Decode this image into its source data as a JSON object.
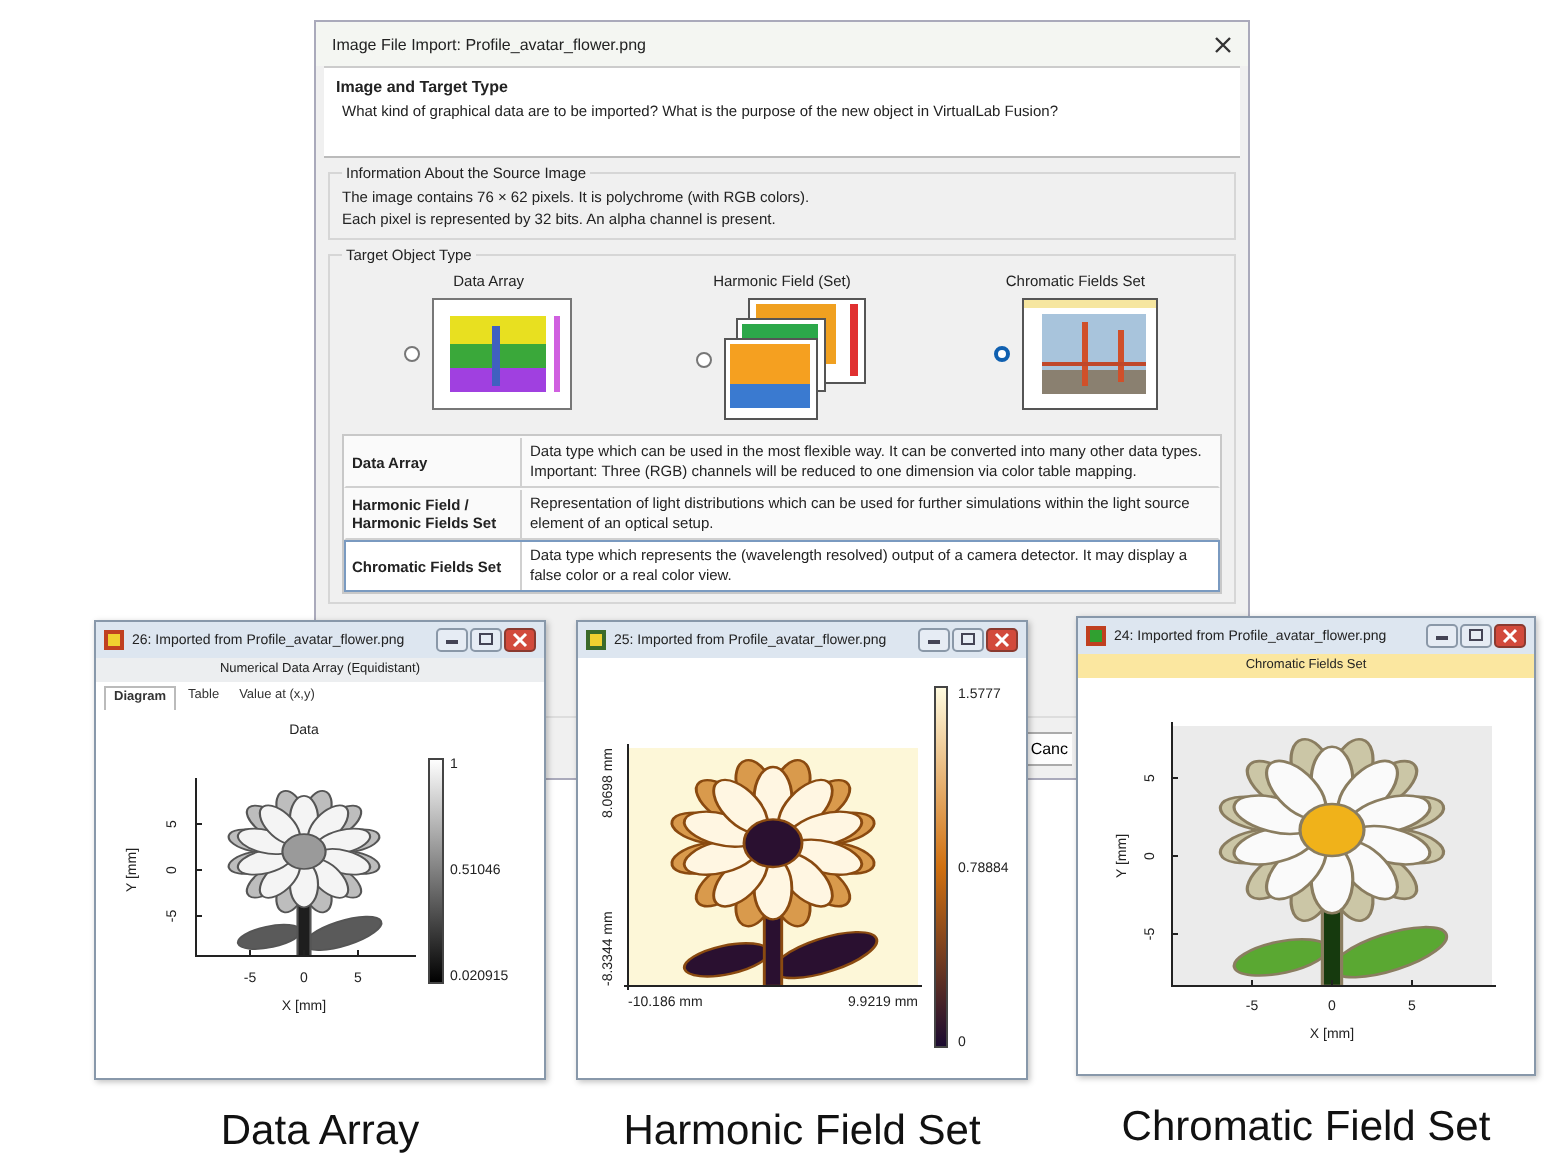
{
  "dialog": {
    "title": "Image File Import: Profile_avatar_flower.png"
  },
  "header": {
    "title": "Image and Target Type",
    "subtitle": "What kind of graphical data are to be imported? What is the purpose of the new object in VirtualLab Fusion?"
  },
  "source_info": {
    "legend": "Information About the Source Image",
    "lines": [
      "The image contains 76 × 62 pixels. It is polychrome (with RGB colors).",
      "Each pixel is represented by 32 bits. An alpha channel is present."
    ]
  },
  "target_type": {
    "legend": "Target Object Type",
    "options": [
      {
        "label": "Data Array",
        "kind": "data_array",
        "selected": false
      },
      {
        "label": "Harmonic Field (Set)",
        "kind": "harmonic",
        "selected": false
      },
      {
        "label": "Chromatic Fields Set",
        "kind": "chromatic",
        "selected": true
      }
    ]
  },
  "types_table": {
    "rows": [
      {
        "name": "Data Array",
        "description": "Data type which can be used in the most flexible way. It can be converted into many other data types. Important: Three (RGB) channels will be reduced to one dimension via color table mapping.",
        "selected": false
      },
      {
        "name": "Harmonic Field / Harmonic Fields Set",
        "description": "Representation of light distributions which can be used for further simulations within the light source element of an optical setup.",
        "selected": false
      },
      {
        "name": "Chromatic Fields Set",
        "description": "Data type which represents the (wavelength resolved) output of a camera detector. It may display a false color or a real color view.",
        "selected": true
      }
    ]
  },
  "cancel_button": "Canc",
  "windows": [
    {
      "kind": "data_array",
      "title": "26: Imported from Profile_avatar_flower.png",
      "subtitle": "Numerical Data Array (Equidistant)",
      "tabs": [
        {
          "label": "Diagram",
          "selected": true
        },
        {
          "label": "Table",
          "selected": false
        },
        {
          "label": "Value at (x,y)",
          "selected": false
        }
      ],
      "plot_title": "Data",
      "xlabel": "X [mm]",
      "ylabel": "Y [mm]",
      "xticks": [
        "-5",
        "0",
        "5"
      ],
      "yticks": [
        "5",
        "0",
        "-5"
      ],
      "colorbar_ticks": [
        "1",
        "0.51046",
        "0.020915"
      ],
      "caption": "Data Array"
    },
    {
      "kind": "harmonic",
      "title": "25: Imported from Profile_avatar_flower.png",
      "xticks": [
        "-10.186 mm",
        "9.9219 mm"
      ],
      "yticks": [
        "8.0698 mm",
        "-8.3344 mm"
      ],
      "colorbar_ticks": [
        "1.5777",
        "0.78884",
        "0"
      ],
      "caption": "Harmonic Field Set"
    },
    {
      "kind": "chromatic",
      "title": "24: Imported from Profile_avatar_flower.png",
      "subtitle": "Chromatic Fields Set",
      "xlabel": "X [mm]",
      "ylabel": "Y [mm]",
      "xticks": [
        "-5",
        "0",
        "5"
      ],
      "yticks": [
        "5",
        "0",
        "-5"
      ],
      "caption": "Chromatic Field Set"
    }
  ]
}
